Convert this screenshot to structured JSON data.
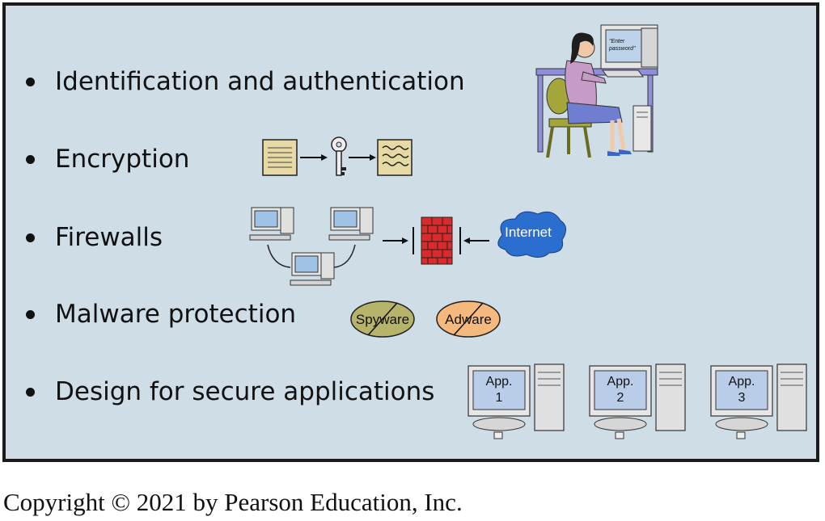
{
  "bullets": [
    "Identification and authentication",
    "Encryption",
    "Firewalls",
    "Malware protection",
    "Design for secure applications"
  ],
  "icons": {
    "password_screen_text": "\"Enter password\"",
    "internet_cloud_label": "Internet",
    "spyware_label": "Spyware",
    "adware_label": "Adware",
    "app_labels": [
      {
        "line1": "App.",
        "line2": "1"
      },
      {
        "line1": "App.",
        "line2": "2"
      },
      {
        "line1": "App.",
        "line2": "3"
      }
    ]
  },
  "colors": {
    "panel_background": "#cfdde6",
    "firewall_red": "#d92b2b",
    "cloud_blue": "#2a6fd0",
    "spyware_fill": "#b5b46a",
    "adware_fill": "#f6b97d",
    "document_fill": "#e6d9a4"
  },
  "footer": {
    "copyright": "Copyright © 2021 by Pearson Education, Inc."
  }
}
